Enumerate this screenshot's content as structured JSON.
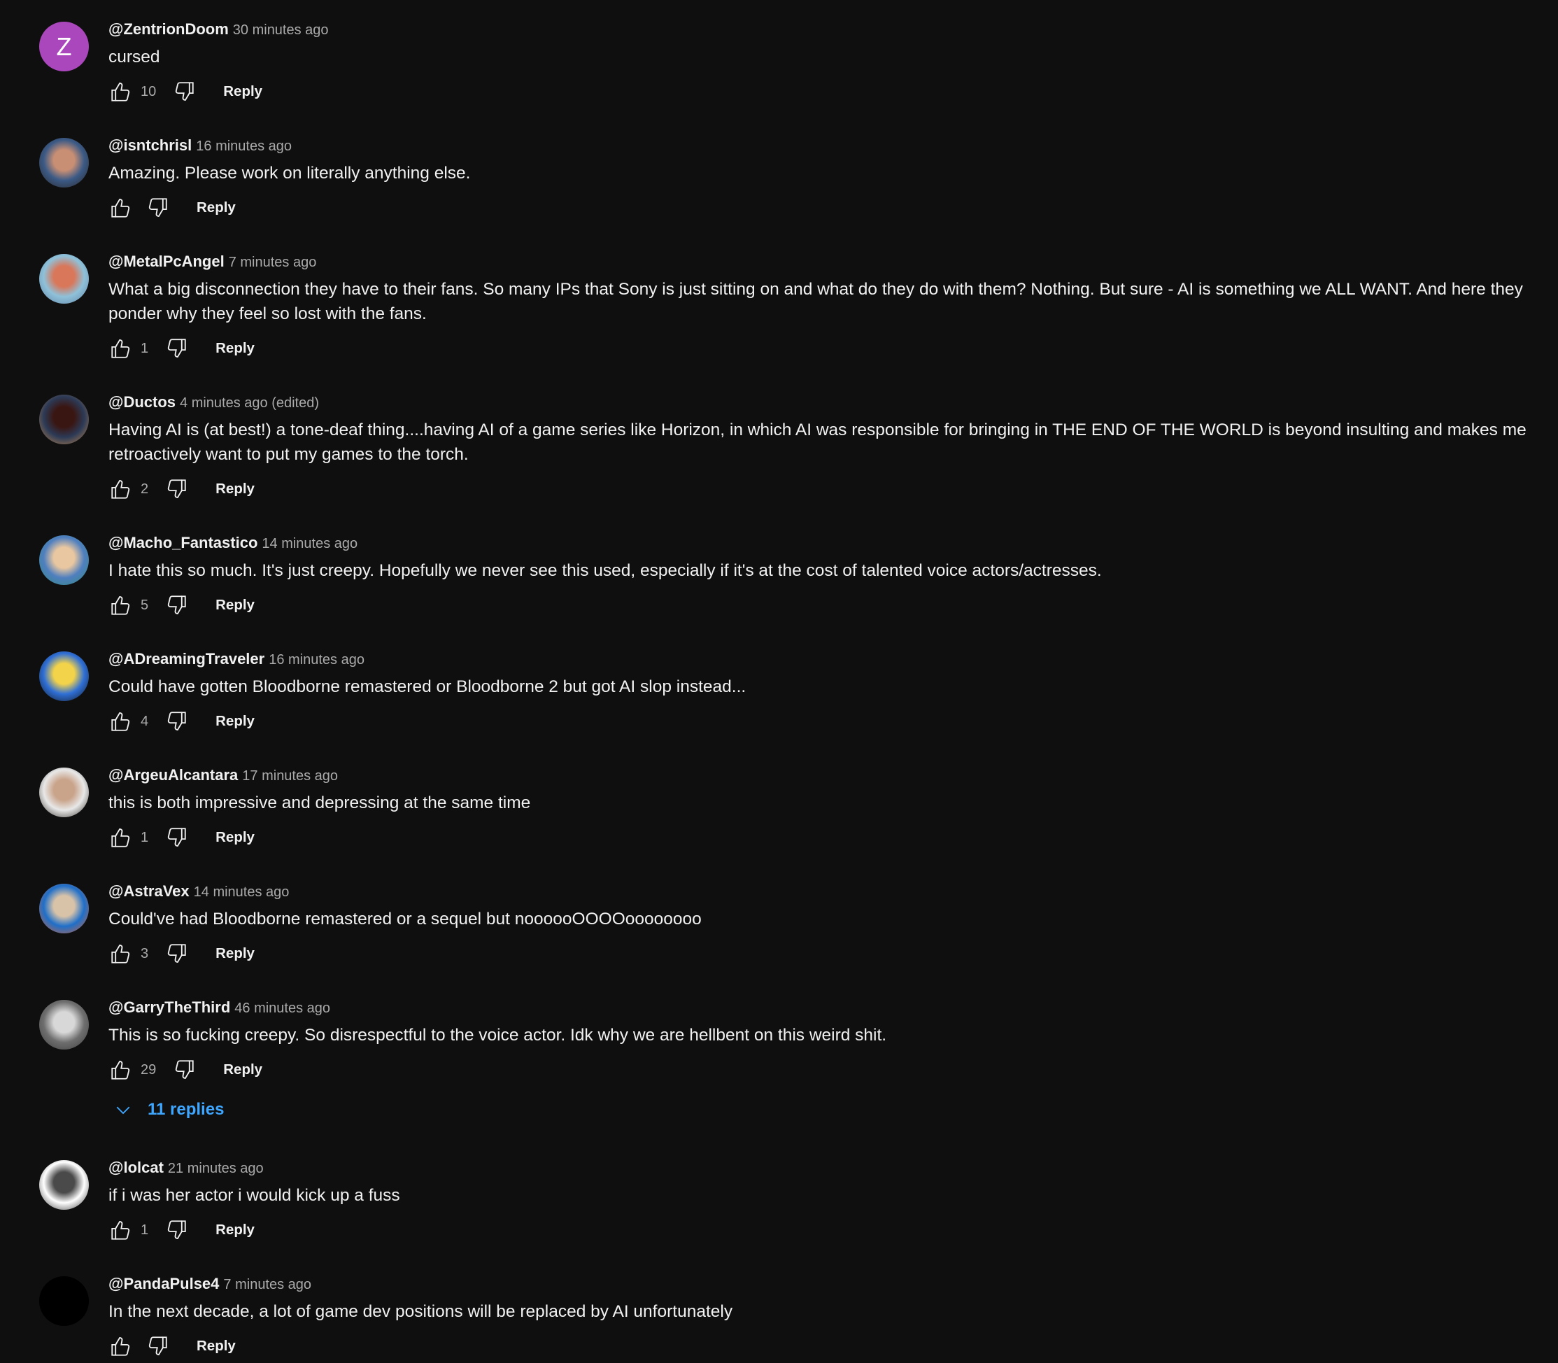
{
  "comments": [
    {
      "handle": "@ZentrionDoom",
      "time": "30 minutes ago",
      "text": "cursed",
      "likes": "10",
      "reply_label": "Reply",
      "avatar": {
        "type": "letter",
        "letter": "Z",
        "color": "#ab47bc"
      }
    },
    {
      "handle": "@isntchrisl",
      "time": "16 minutes ago",
      "text": "Amazing. Please work on literally anything else.",
      "likes": "",
      "reply_label": "Reply",
      "avatar": {
        "type": "photo",
        "colors": [
          "#3b5a86",
          "#c98f74",
          "#2b2420"
        ]
      }
    },
    {
      "handle": "@MetalPcAngel",
      "time": "7 minutes ago",
      "text": "What a big disconnection they have to their fans. So many IPs that Sony is just sitting on and what do they do with them? Nothing. But sure - AI is something we ALL WANT. And here they ponder why they feel so lost with the fans.",
      "likes": "1",
      "reply_label": "Reply",
      "avatar": {
        "type": "photo",
        "colors": [
          "#8fc1d9",
          "#d9775a",
          "#5d7fa3"
        ]
      }
    },
    {
      "handle": "@Ductos",
      "time": "4 minutes ago (edited)",
      "text": "Having AI is (at best!) a tone-deaf thing....having AI of a game series like Horizon, in which AI was responsible for bringing in THE END OF THE WORLD is beyond insulting and makes me retroactively want to put my games to the torch.",
      "likes": "2",
      "reply_label": "Reply",
      "avatar": {
        "type": "photo",
        "colors": [
          "#2c3a56",
          "#3a1612",
          "#c58a4c"
        ]
      }
    },
    {
      "handle": "@Macho_Fantastico",
      "time": "14 minutes ago",
      "text": "I hate this so much. It's just creepy. Hopefully we never see this used, especially if it's at the cost of talented voice actors/actresses.",
      "likes": "5",
      "reply_label": "Reply",
      "avatar": {
        "type": "photo",
        "colors": [
          "#4f7fbf",
          "#e9c7a0",
          "#2f8a7a"
        ]
      }
    },
    {
      "handle": "@ADreamingTraveler",
      "time": "16 minutes ago",
      "text": "Could have gotten Bloodborne remastered or Bloodborne 2 but got AI slop instead...",
      "likes": "4",
      "reply_label": "Reply",
      "avatar": {
        "type": "photo",
        "colors": [
          "#2f6fd6",
          "#f3d34a",
          "#111111"
        ]
      }
    },
    {
      "handle": "@ArgeuAlcantara",
      "time": "17 minutes ago",
      "text": "this is both impressive and depressing at the same time",
      "likes": "1",
      "reply_label": "Reply",
      "avatar": {
        "type": "photo",
        "colors": [
          "#e8e8e8",
          "#c9a48b",
          "#2a2420"
        ]
      }
    },
    {
      "handle": "@AstraVex",
      "time": "14 minutes ago",
      "text": "Could've had Bloodborne remastered or a sequel but noooooOOOOoooooooo",
      "likes": "3",
      "reply_label": "Reply",
      "avatar": {
        "type": "photo",
        "colors": [
          "#1f6fc9",
          "#d9c3a8",
          "#e0622e"
        ]
      }
    },
    {
      "handle": "@GarryTheThird",
      "time": "46 minutes ago",
      "text": "This is so fucking creepy. So disrespectful to the voice actor. Idk why we are hellbent on this weird shit.",
      "likes": "29",
      "reply_label": "Reply",
      "replies_label": "11 replies",
      "avatar": {
        "type": "photo",
        "colors": [
          "#6e6e6e",
          "#d8d8d8",
          "#3a3a3a"
        ]
      }
    },
    {
      "handle": "@lolcat",
      "time": "21 minutes ago",
      "text": "if i was her actor i would kick up a fuss",
      "likes": "1",
      "reply_label": "Reply",
      "avatar": {
        "type": "photo",
        "colors": [
          "#ffffff",
          "#4a4a4a",
          "#2b2b2b"
        ]
      }
    },
    {
      "handle": "@PandaPulse4",
      "time": "7 minutes ago",
      "text": "In the next decade, a lot of game dev positions will be replaced by AI unfortunately",
      "likes": "",
      "reply_label": "Reply",
      "avatar": {
        "type": "solid",
        "color": "#000000"
      }
    }
  ],
  "colors": {
    "background": "#0f0f0f",
    "text": "#f1f1f1",
    "secondary_text": "#aaaaaa",
    "link_blue": "#3ea6ff"
  }
}
